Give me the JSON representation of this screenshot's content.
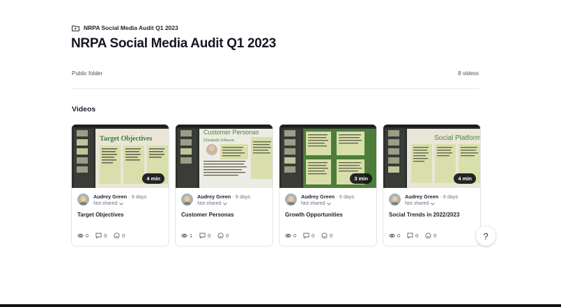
{
  "breadcrumb": {
    "icon": "folder-play-icon",
    "label": "NRPA Social Media Audit Q1 2023"
  },
  "page": {
    "title": "NRPA Social Media Audit Q1 2023",
    "visibility": "Public folder",
    "video_count": "8 videos"
  },
  "section": {
    "title": "Videos"
  },
  "videos": [
    {
      "title": "Target Objectives",
      "duration": "4 min",
      "author": "Audrey Green",
      "age": "· 9 days",
      "share_status": "Not shared",
      "views": "0",
      "comments": "0",
      "reactions": "0",
      "thumb": {
        "heading": "Target Objectives",
        "heading_color": "#3f7d2e",
        "bg": "#e9e6d8",
        "panel": "#d9dfaa"
      }
    },
    {
      "title": "Customer Personas",
      "duration": "",
      "author": "Audrey Green",
      "age": "· 9 days",
      "share_status": "Not shared",
      "views": "1",
      "comments": "0",
      "reactions": "0",
      "thumb": {
        "heading": "Customer Personas",
        "subheading": "Elizabeth Johnson",
        "heading_color": "#4a8a2f",
        "bg": "#ecebe4",
        "panel": "#d9dfaa"
      }
    },
    {
      "title": "Growth Opportunities",
      "duration": "3 min",
      "author": "Audrey Green",
      "age": "· 9 days",
      "share_status": "Not shared",
      "views": "0",
      "comments": "0",
      "reactions": "0",
      "thumb": {
        "heading": "",
        "heading_color": "#3f7d2e",
        "bg": "#4d7d3a",
        "panel": "#d9dfaa"
      }
    },
    {
      "title": "Social Trends in 2022/2023",
      "duration": "4 min",
      "author": "Audrey Green",
      "age": "· 9 days",
      "share_status": "Not shared",
      "views": "0",
      "comments": "0",
      "reactions": "0",
      "thumb": {
        "heading": "Social Platform T",
        "heading_color": "#4a8a2f",
        "bg": "#e9e6d8",
        "panel": "#d9dfaa"
      }
    }
  ],
  "help": {
    "label": "?"
  },
  "icons": {
    "views": "eye-icon",
    "comments": "comment-icon",
    "reactions": "smiley-icon",
    "chevron": "chevron-down-icon"
  }
}
